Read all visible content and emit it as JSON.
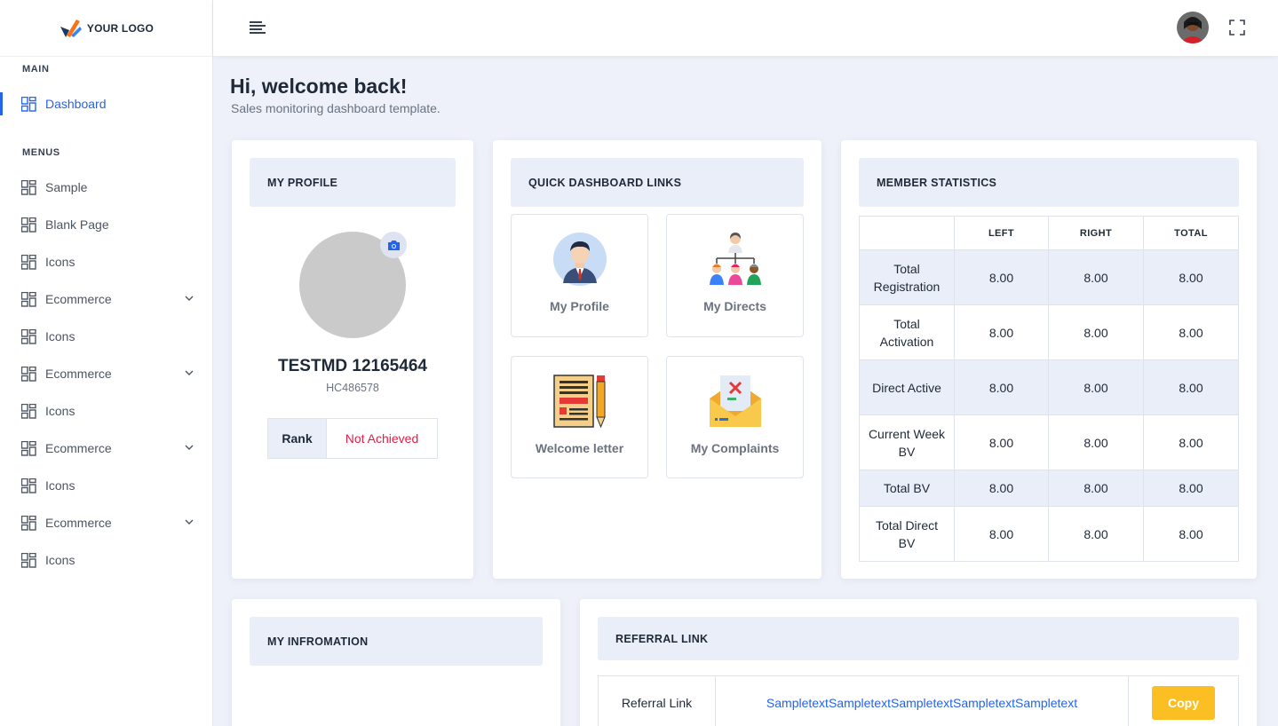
{
  "brand": {
    "logo_text": "YOUR LOGO"
  },
  "sidebar": {
    "main_label": "MAIN",
    "menus_label": "MENUS",
    "dashboard": "Dashboard",
    "items": [
      {
        "label": "Sample",
        "has_children": false
      },
      {
        "label": "Blank Page",
        "has_children": false
      },
      {
        "label": "Icons",
        "has_children": false
      },
      {
        "label": "Ecommerce",
        "has_children": true
      },
      {
        "label": "Icons",
        "has_children": false
      },
      {
        "label": "Ecommerce",
        "has_children": true
      },
      {
        "label": "Icons",
        "has_children": false
      },
      {
        "label": "Ecommerce",
        "has_children": true
      },
      {
        "label": "Icons",
        "has_children": false
      },
      {
        "label": "Ecommerce",
        "has_children": true
      },
      {
        "label": "Icons",
        "has_children": false
      }
    ]
  },
  "header": {
    "title": "Hi, welcome back!",
    "subtitle": "Sales monitoring dashboard template."
  },
  "profile": {
    "heading": "MY PROFILE",
    "name": "TESTMD 12165464",
    "id": "HC486578",
    "rank_label": "Rank",
    "rank_value": "Not Achieved"
  },
  "quick_links": {
    "heading": "QUICK DASHBOARD LINKS",
    "items": [
      {
        "label": "My Profile",
        "icon": "person-icon"
      },
      {
        "label": "My Directs",
        "icon": "team-hierarchy-icon"
      },
      {
        "label": "Welcome letter",
        "icon": "letter-pencil-icon"
      },
      {
        "label": "My Complaints",
        "icon": "envelope-complaint-icon"
      }
    ]
  },
  "member_stats": {
    "heading": "MEMBER STATISTICS",
    "columns": [
      "",
      "LEFT",
      "RIGHT",
      "TOTAL"
    ],
    "rows": [
      {
        "label": "Total Registration",
        "left": "8.00",
        "right": "8.00",
        "total": "8.00"
      },
      {
        "label": "Total Activation",
        "left": "8.00",
        "right": "8.00",
        "total": "8.00"
      },
      {
        "label": "Direct Active",
        "left": "8.00",
        "right": "8.00",
        "total": "8.00"
      },
      {
        "label": "Current Week BV",
        "left": "8.00",
        "right": "8.00",
        "total": "8.00"
      },
      {
        "label": "Total BV",
        "left": "8.00",
        "right": "8.00",
        "total": "8.00"
      },
      {
        "label": "Total Direct BV",
        "left": "8.00",
        "right": "8.00",
        "total": "8.00"
      }
    ]
  },
  "information": {
    "heading": "MY INFROMATION"
  },
  "referral": {
    "heading": "REFERRAL LINK",
    "label": "Referral Link",
    "link": "SampletextSampletextSampletextSampletextSampletext",
    "copy_label": "Copy"
  },
  "colors": {
    "accent": "#2563eb",
    "background": "#eef1f9",
    "card_header": "#eaeef8",
    "danger": "#e11d48",
    "copy_button": "#fbbf24"
  }
}
